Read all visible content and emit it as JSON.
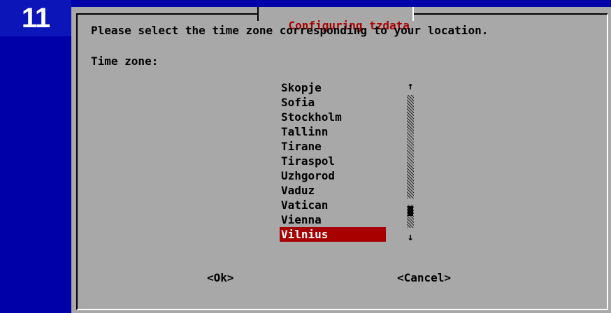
{
  "badge": "11",
  "dialog": {
    "title": "Configuring tzdata",
    "prompt": "Please select the time zone corresponding to your location.",
    "field_label": "Time zone:",
    "items": [
      "Skopje",
      "Sofia",
      "Stockholm",
      "Tallinn",
      "Tirane",
      "Tiraspol",
      "Uzhgorod",
      "Vaduz",
      "Vatican",
      "Vienna",
      "Vilnius"
    ],
    "selected": "Vilnius",
    "scroll_up": "↑",
    "scroll_down": "↓",
    "ok_label": "<Ok>",
    "cancel_label": "<Cancel>"
  },
  "colors": {
    "background": "#0000a8",
    "dialog": "#a8a8a8",
    "title": "#a80000",
    "selection": "#a80000"
  }
}
